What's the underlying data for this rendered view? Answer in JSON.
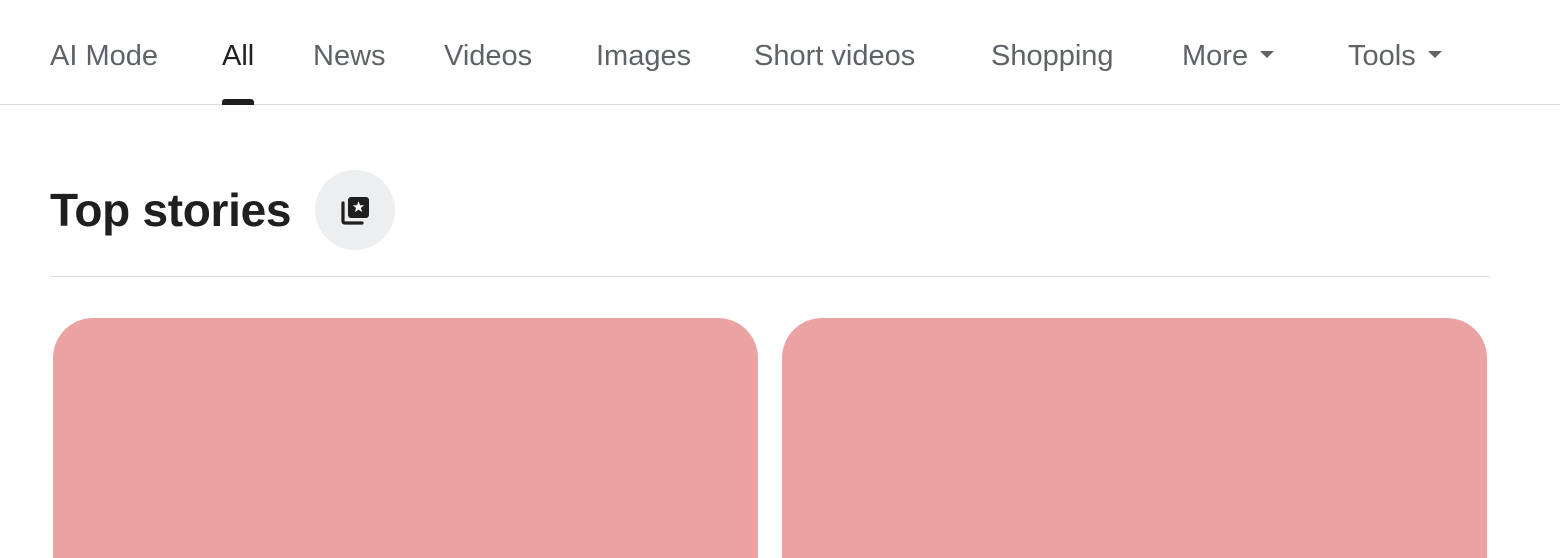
{
  "tabs": {
    "items": [
      {
        "label": "AI Mode"
      },
      {
        "label": "All"
      },
      {
        "label": "News"
      },
      {
        "label": "Videos"
      },
      {
        "label": "Images"
      },
      {
        "label": "Short videos"
      },
      {
        "label": "Shopping"
      },
      {
        "label": "More"
      },
      {
        "label": "Tools"
      }
    ],
    "active": "All"
  },
  "top_stories": {
    "title": "Top stories",
    "icon": "stories-icon"
  },
  "cards": [
    {
      "color": "#eba2a3"
    },
    {
      "color": "#eba2a3"
    }
  ],
  "colors": {
    "active_tab": "#1f1f1f",
    "inactive_tab": "#5f6368",
    "divider": "#dadce0",
    "icon_button_bg": "#eceef0",
    "card_placeholder": "#eba2a3"
  }
}
